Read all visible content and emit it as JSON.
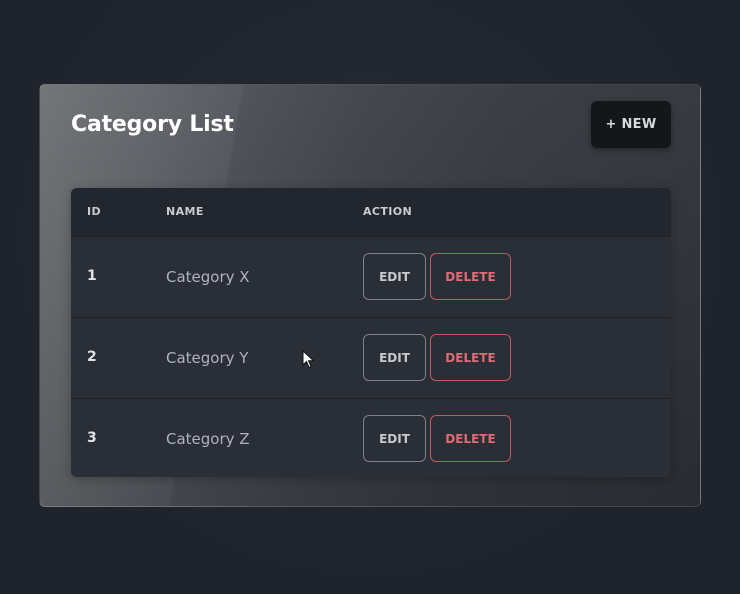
{
  "card": {
    "title": "Category List",
    "new_button_label": "+ NEW"
  },
  "table": {
    "headers": [
      "ID",
      "NAME",
      "ACTION"
    ],
    "rows": [
      {
        "id": "1",
        "name": "Category X",
        "edit_label": "EDIT",
        "delete_label": "DELETE"
      },
      {
        "id": "2",
        "name": "Category Y",
        "edit_label": "EDIT",
        "delete_label": "DELETE"
      },
      {
        "id": "3",
        "name": "Category Z",
        "edit_label": "EDIT",
        "delete_label": "DELETE"
      }
    ]
  },
  "colors": {
    "background": "#1f232b",
    "table_bg": "#2a2e37",
    "delete_accent": "#e06b72",
    "new_button_bg": "#14161a"
  },
  "icons": {
    "cursor": "mouse-pointer-icon"
  }
}
